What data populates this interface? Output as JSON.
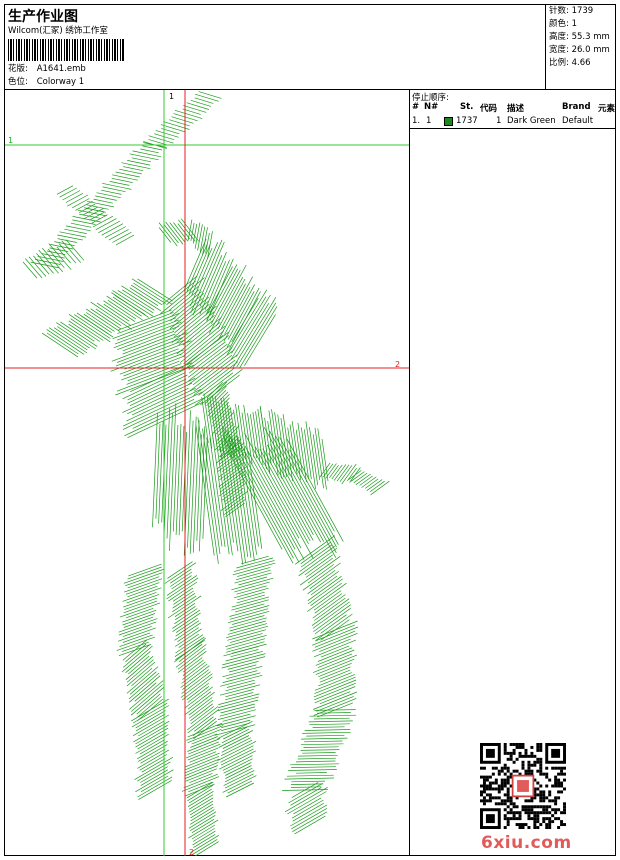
{
  "header": {
    "title": "生产作业图",
    "company": "Wilcom(汇冢) 绣饰工作室",
    "design_label": "花版:",
    "design_value": "A1641.emb",
    "colorway_label": "色位:",
    "colorway_value": "Colorway 1"
  },
  "stats": [
    {
      "label": "针数:",
      "value": "1739"
    },
    {
      "label": "颜色:",
      "value": "1"
    },
    {
      "label": "高度:",
      "value": "55.3 mm"
    },
    {
      "label": "宽度:",
      "value": "26.0 mm"
    },
    {
      "label": "比例:",
      "value": "4.66"
    }
  ],
  "guides": {
    "green_vertical_label": "1",
    "green_horizontal_label": "1",
    "red_horizontal_label": "2",
    "red_vertical_label": "2"
  },
  "stop_sequence": {
    "caption": "停止顺序:",
    "columns": [
      "#",
      "N#",
      "St.",
      "代码",
      "描述",
      "Brand",
      "元素"
    ],
    "rows": [
      {
        "index": "1.",
        "n": "1",
        "stitches": "1737",
        "code": "1",
        "description": "Dark Green",
        "brand": "Default",
        "element": "",
        "color": "#1a8a1a"
      }
    ]
  },
  "watermark": {
    "site": "6xiu.com"
  },
  "colors": {
    "thread": "#1a9a1a",
    "guide_green": "#33cc33",
    "guide_red": "#e02020",
    "watermark": "#e25b5b"
  }
}
